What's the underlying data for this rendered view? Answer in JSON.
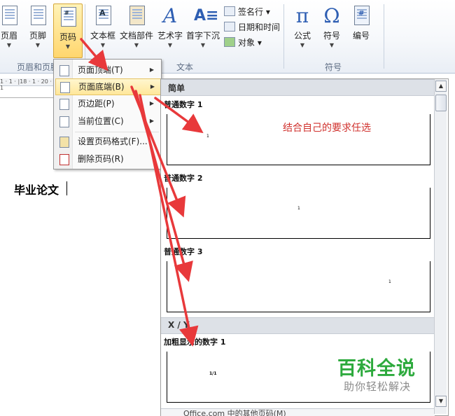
{
  "ribbon": {
    "buttons": [
      {
        "label": "页眉"
      },
      {
        "label": "页脚"
      },
      {
        "label": "页码"
      },
      {
        "label": "文本框"
      },
      {
        "label": "文档部件"
      },
      {
        "label": "艺术字"
      },
      {
        "label": "首字下沉"
      },
      {
        "label": "公式"
      },
      {
        "label": "符号"
      },
      {
        "label": "编号"
      }
    ],
    "small_items": [
      "签名行",
      "日期和时间",
      "对象"
    ],
    "groups": [
      "页眉和页脚",
      "文本",
      "符号"
    ]
  },
  "document": {
    "ruler": "1 · 1 · |18 · 1 · 20 · 1",
    "title": "毕业论文"
  },
  "menu": {
    "items": [
      {
        "label": "页面顶端(T)",
        "submenu": true
      },
      {
        "label": "页面底端(B)",
        "submenu": true,
        "highlighted": true
      },
      {
        "label": "页边距(P)",
        "submenu": true
      },
      {
        "label": "当前位置(C)",
        "submenu": true
      },
      {
        "label": "设置页码格式(F)..."
      },
      {
        "label": "删除页码(R)"
      }
    ]
  },
  "gallery": {
    "sections": [
      {
        "header": "简单"
      },
      {
        "header": "X / Y"
      }
    ],
    "items": [
      {
        "name": "普通数字 1",
        "sample": "1",
        "align": "left"
      },
      {
        "name": "普通数字 2",
        "sample": "1",
        "align": "center"
      },
      {
        "name": "普通数字 3",
        "sample": "1",
        "align": "right"
      },
      {
        "name": "加粗显示的数字 1",
        "sample": "1/1",
        "align": "left"
      }
    ],
    "footer_partial": "Office.com 中的其他页码(M)"
  },
  "annotation": "结合自己的要求任选",
  "watermark": {
    "title": "百科全说",
    "subtitle": "助你轻松解决"
  },
  "colors": {
    "highlight": "#ffe79a",
    "annotation": "#d0312d",
    "arrow": "#e8393b",
    "watermark": "#2daa3d"
  }
}
